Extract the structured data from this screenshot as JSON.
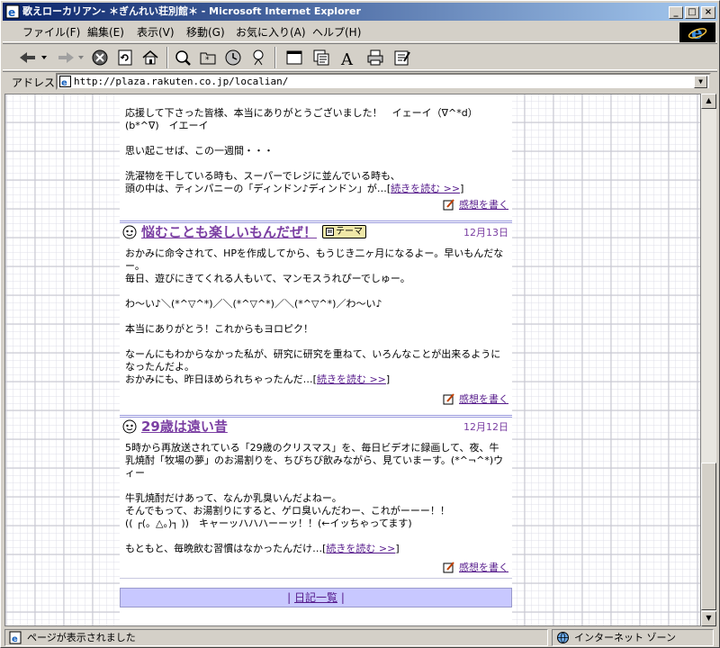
{
  "window": {
    "title": "歌えローカリアン- ＊ぎんれい荘別館＊ - Microsoft Internet Explorer"
  },
  "menu": [
    "ファイル(F)",
    "編集(E)",
    "表示(V)",
    "移動(G)",
    "お気に入り(A)",
    "ヘルプ(H)"
  ],
  "address": {
    "label": "アドレス",
    "url": "http://plaza.rakuten.co.jp/localian/"
  },
  "entries": [
    {
      "body": "応援して下さった皆様、本当にありがとうございました！　イェーイ（∇^*d）\n(b*^∇)　イエーイ\n\n思い起こせば、この一週間・・・\n\n洗濯物を干している時も、スーパーでレジに並んでいる時も、\n頭の中は、ティンパニーの「ディンドン♪ディンドン」が…",
      "more": "続きを読む >>",
      "comment": "感想を書く"
    },
    {
      "title": "悩むことも楽しいもんだぜ！",
      "theme": "テーマ",
      "date": "12月13日",
      "body": "おかみに命令されて、HPを作成してから、もうじき二ヶ月になるよー。早いもんだなー。\n毎日、遊びにきてくれる人もいて、マンモスうれぴーでしゅー。\n\nわ～い♪＼(*^▽^*)／＼(*^▽^*)／＼(*^▽^*)／わ～い♪\n\n本当にありがとう！これからもヨロピク！\n\nなーんにもわからなかった私が、研究に研究を重ねて、いろんなことが出来るようになったんだよ。\nおかみにも、昨日ほめられちゃったんだ…",
      "more": "続きを読む >>",
      "comment": "感想を書く"
    },
    {
      "title": "29歳は遠い昔",
      "date": "12月12日",
      "body": "5時から再放送されている「29歳のクリスマス」を、毎日ビデオに録画して、夜、牛乳焼酎「牧場の夢」のお湯割りを、ちびちび飲みながら、見ていまーす。(*^¬^*)ウィー\n\n牛乳焼酎だけあって、なんか乳臭いんだよねー。\nそんでもって、お湯割りにすると、ゲロ臭いんだわー、これがーーー！！\n(( ┌(。△。)┐ ))　キャーッハハハーーッ！！(←イッちゃってます)\n\nもともと、毎晩飲む習慣はなかったんだけ…",
      "more": "続きを読む >>",
      "comment": "感想を書く"
    }
  ],
  "footer": {
    "link": "日記一覧"
  },
  "status": {
    "text": "ページが表示されました",
    "zone": "インターネット ゾーン"
  }
}
